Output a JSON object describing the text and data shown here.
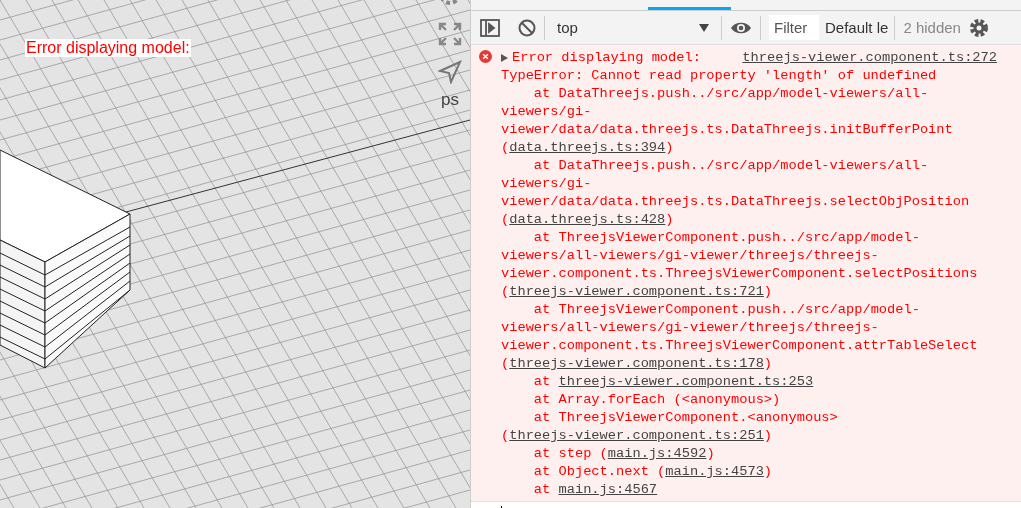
{
  "viewer": {
    "error_label": "Error displaying model:",
    "side_label": "ps"
  },
  "devtools": {
    "toolbar": {
      "context": "top",
      "filter": {
        "placeholder": "Filter"
      },
      "levels": "Default le",
      "hidden_count": "2 hidden"
    },
    "console": {
      "messages": [
        {
          "kind": "error",
          "expanded": false,
          "summary": "Error displaying model:",
          "source": "threejs-viewer.component.ts:272",
          "lines": [
            {
              "text": "TypeError: Cannot read property 'length' of undefined"
            },
            {
              "text": "    at DataThreejs.push../src/app/model-viewers/all-viewers/gi-viewer/data/data.threejs.ts.DataThreejs.initBufferPoint (",
              "link": "data.threejs.ts:394",
              "after": ")"
            },
            {
              "text": "    at DataThreejs.push../src/app/model-viewers/all-viewers/gi-viewer/data/data.threejs.ts.DataThreejs.selectObjPosition (",
              "link": "data.threejs.ts:428",
              "after": ")"
            },
            {
              "text": "    at ThreejsViewerComponent.push../src/app/model-viewers/all-viewers/gi-viewer/threejs/threejs-viewer.component.ts.ThreejsViewerComponent.selectPositions (",
              "link": "threejs-viewer.component.ts:721",
              "after": ")"
            },
            {
              "text": "    at ThreejsViewerComponent.push../src/app/model-viewers/all-viewers/gi-viewer/threejs/threejs-viewer.component.ts.ThreejsViewerComponent.attrTableSelect (",
              "link": "threejs-viewer.component.ts:178",
              "after": ")"
            },
            {
              "text": "    at ",
              "link": "threejs-viewer.component.ts:253"
            },
            {
              "text": "    at Array.forEach (<anonymous>)"
            },
            {
              "text": "    at ThreejsViewerComponent.<anonymous> (",
              "link": "threejs-viewer.component.ts:251",
              "after": ")"
            },
            {
              "text": "    at step (",
              "link": "main.js:4592",
              "after": ")"
            },
            {
              "text": "    at Object.next (",
              "link": "main.js:4573",
              "after": ")"
            },
            {
              "text": "    at ",
              "link": "main.js:4567"
            }
          ]
        }
      ]
    }
  }
}
